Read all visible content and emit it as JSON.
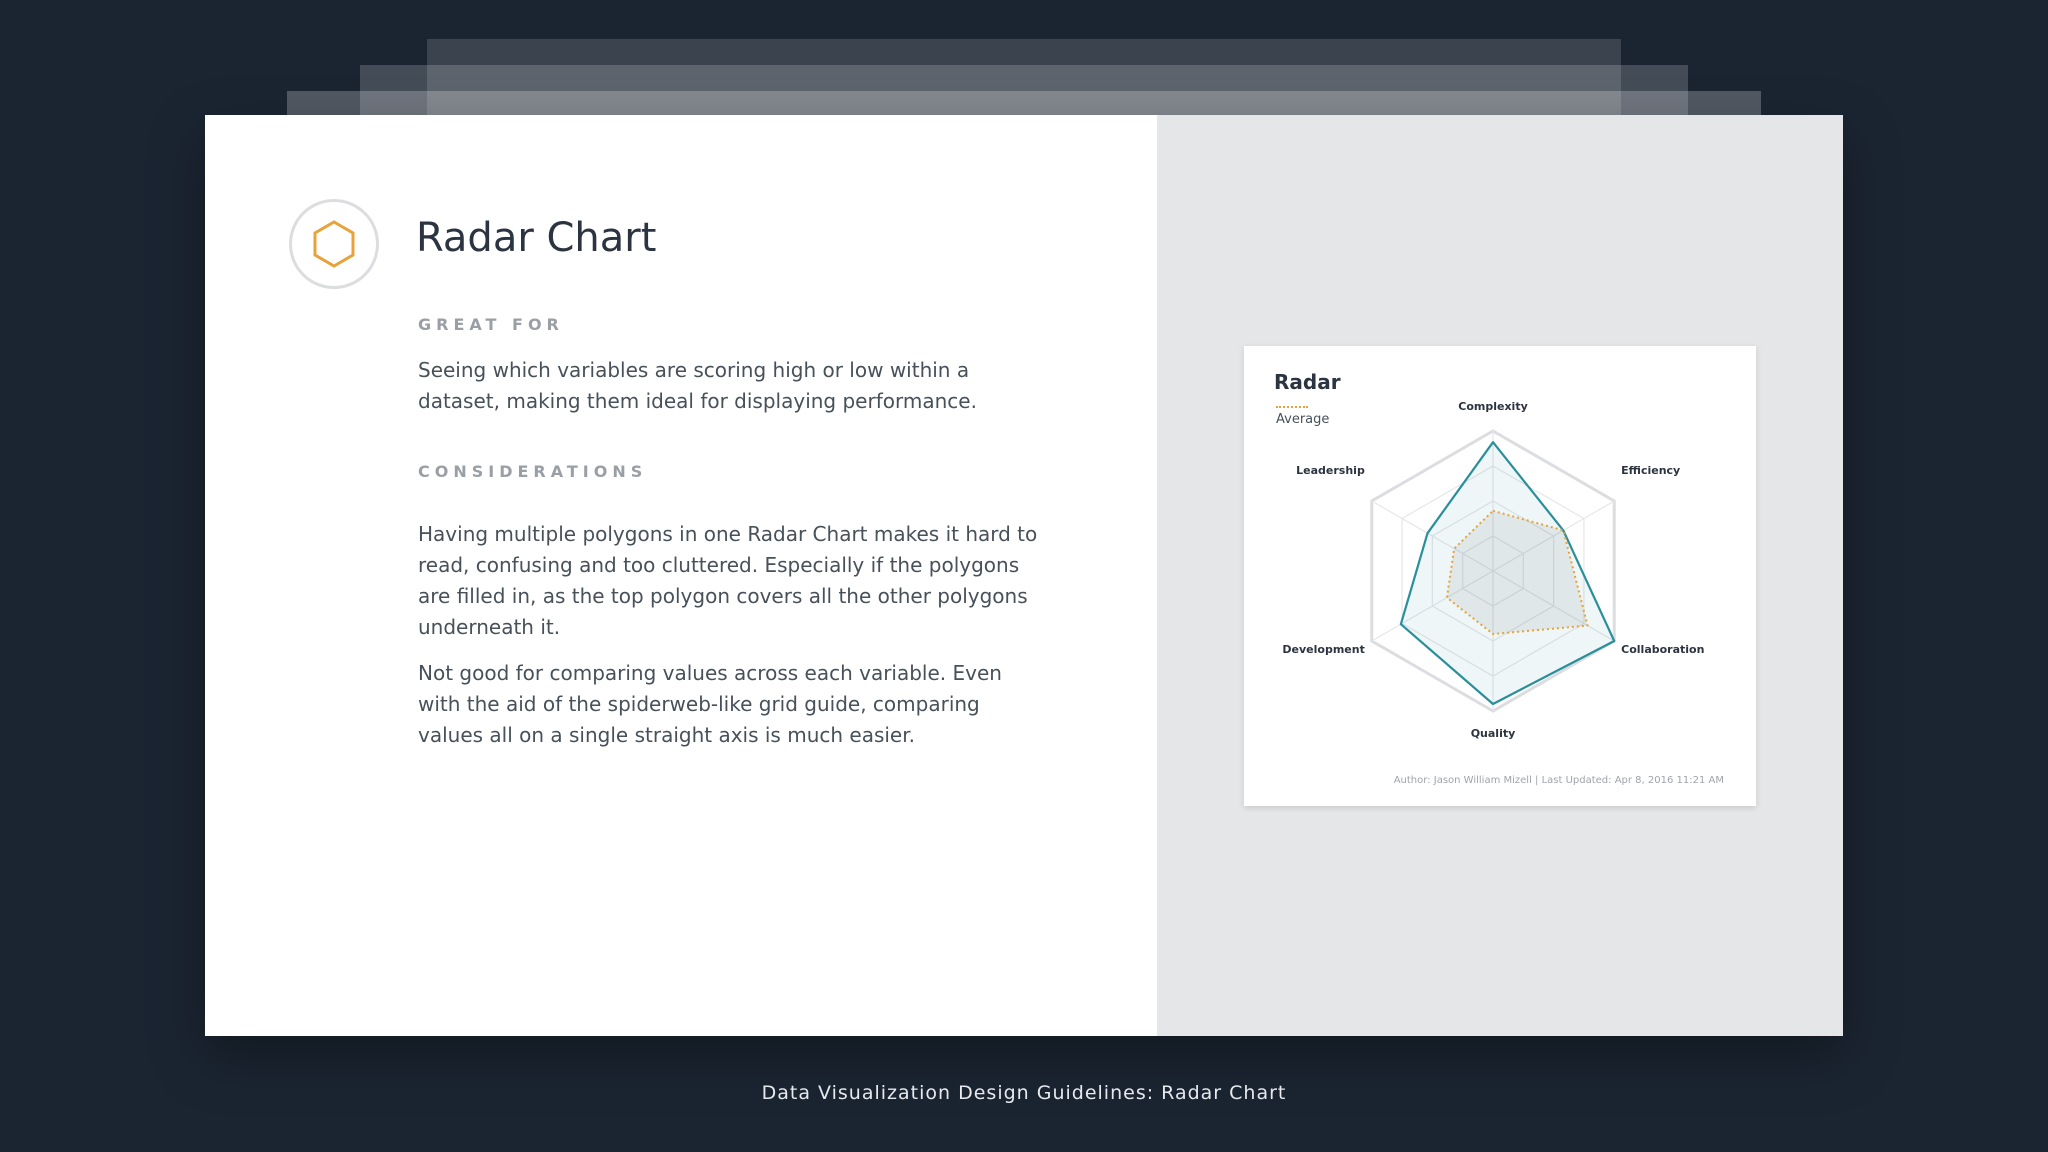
{
  "page": {
    "title": "Radar Chart",
    "caption": "Data Visualization Design Guidelines: Radar Chart",
    "icon": "hexagon-icon",
    "accent_color": "#e8a23a"
  },
  "great_for": {
    "label": "GREAT FOR",
    "text": "Seeing which variables are scoring high or low within a dataset, making them ideal for displaying performance."
  },
  "considerations": {
    "label": "CONSIDERATIONS",
    "paragraphs": [
      "Having multiple polygons in one Radar Chart makes it hard to read, confusing and too cluttered. Especially if the polygons are filled in, as the top polygon covers all the other polygons underneath it.",
      "Not good for comparing values across each variable. Even with the aid of the spiderweb-like grid guide, comparing values all on a single straight axis is much easier."
    ]
  },
  "chart_card": {
    "title": "Radar",
    "footer": "Author: Jason William Mizell  |  Last Updated: Apr 8, 2016 11:21 AM"
  },
  "chart_data": {
    "type": "radar",
    "title": "Radar",
    "axes": [
      "Complexity",
      "Efficiency",
      "Collaboration",
      "Quality",
      "Development",
      "Leadership"
    ],
    "range": [
      0,
      100
    ],
    "grid_levels": 4,
    "legend_position": "top-left",
    "series": [
      {
        "values": [
          92,
          58,
          100,
          95,
          76,
          54
        ],
        "color": "#2a8f9a",
        "fill": "rgba(42,143,154,0.08)",
        "style": "solid"
      },
      {
        "name": "Average",
        "values": [
          43,
          58,
          78,
          45,
          38,
          32
        ],
        "color": "#e8a23a",
        "fill": "rgba(120,120,120,0.12)",
        "style": "dotted"
      }
    ]
  }
}
